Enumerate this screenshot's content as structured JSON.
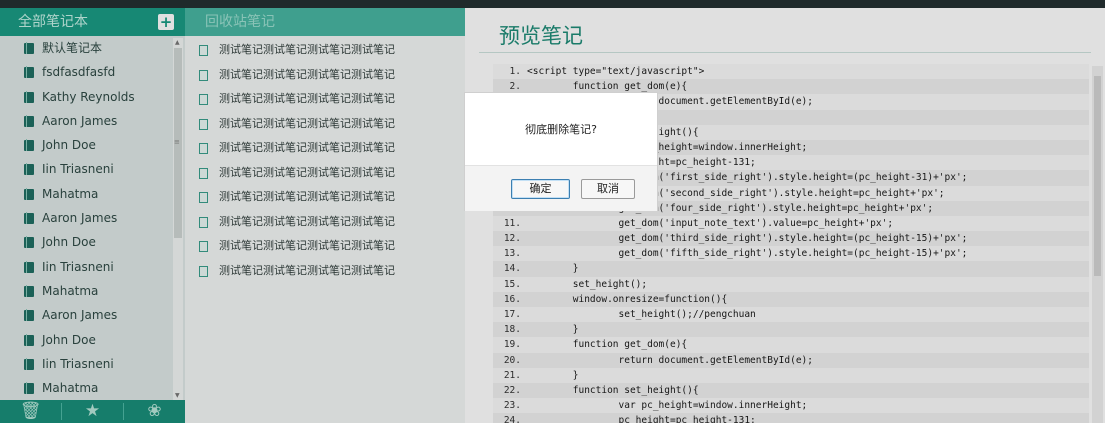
{
  "sidebar": {
    "header_title": "全部笔记本",
    "add_icon": "plus-icon",
    "notebooks": [
      "默认笔记本",
      "fsdfasdfasfd",
      "Kathy Reynolds",
      "Aaron James",
      "John Doe",
      "Iin Triasneni",
      "Mahatma",
      "Aaron James",
      "John Doe",
      "Iin Triasneni",
      "Mahatma",
      "Aaron James",
      "John Doe",
      "Iin Triasneni",
      "Mahatma"
    ],
    "footer_icons": [
      "trash-icon",
      "star-icon",
      "paw-icon"
    ]
  },
  "middle": {
    "header_title": "回收站笔记",
    "notes": [
      "测试笔记测试笔记测试笔记测试笔记",
      "测试笔记测试笔记测试笔记测试笔记",
      "测试笔记测试笔记测试笔记测试笔记",
      "测试笔记测试笔记测试笔记测试笔记",
      "测试笔记测试笔记测试笔记测试笔记",
      "测试笔记测试笔记测试笔记测试笔记",
      "测试笔记测试笔记测试笔记测试笔记",
      "测试笔记测试笔记测试笔记测试笔记",
      "测试笔记测试笔记测试笔记测试笔记",
      "测试笔记测试笔记测试笔记测试笔记"
    ]
  },
  "preview": {
    "title": "预览笔记",
    "code_lines": [
      {
        "n": "1.",
        "t": "<script type=\"text/javascript\">"
      },
      {
        "n": "2.",
        "t": "        function get_dom(e){"
      },
      {
        "n": "3.",
        "t": "                return document.getElementById(e);"
      },
      {
        "n": "4.",
        "t": "        }"
      },
      {
        "n": "5.",
        "t": "        function set_height(){"
      },
      {
        "n": "6.",
        "t": "                var pc_height=window.innerHeight;"
      },
      {
        "n": "7.",
        "t": "                pc_height=pc_height-131;"
      },
      {
        "n": "8.",
        "t": "                get_dom('first_side_right').style.height=(pc_height-31)+'px';"
      },
      {
        "n": "9.",
        "t": "                get_dom('second_side_right').style.height=pc_height+'px';"
      },
      {
        "n": "10.",
        "t": "                get_dom('four_side_right').style.height=pc_height+'px';"
      },
      {
        "n": "11.",
        "t": "                get_dom('input_note_text').value=pc_height+'px';"
      },
      {
        "n": "12.",
        "t": "                get_dom('third_side_right').style.height=(pc_height-15)+'px';"
      },
      {
        "n": "13.",
        "t": "                get_dom('fifth_side_right').style.height=(pc_height-15)+'px';"
      },
      {
        "n": "14.",
        "t": "        }"
      },
      {
        "n": "15.",
        "t": "        set_height();"
      },
      {
        "n": "16.",
        "t": "        window.onresize=function(){"
      },
      {
        "n": "17.",
        "t": "                set_height();//pengchuan"
      },
      {
        "n": "18.",
        "t": "        }"
      },
      {
        "n": "19.",
        "t": "        function get_dom(e){"
      },
      {
        "n": "20.",
        "t": "                return document.getElementById(e);"
      },
      {
        "n": "21.",
        "t": "        }"
      },
      {
        "n": "22.",
        "t": "        function set_height(){"
      },
      {
        "n": "23.",
        "t": "                var pc_height=window.innerHeight;"
      },
      {
        "n": "24.",
        "t": "                pc_height=pc_height-131;"
      }
    ]
  },
  "dialog": {
    "message": "彻底删除笔记?",
    "confirm_label": "确定",
    "cancel_label": "取消"
  },
  "colors": {
    "accent": "#1b9b84",
    "sidebar_bg": "#dfe8e6",
    "title_color": "#1e8c78"
  }
}
